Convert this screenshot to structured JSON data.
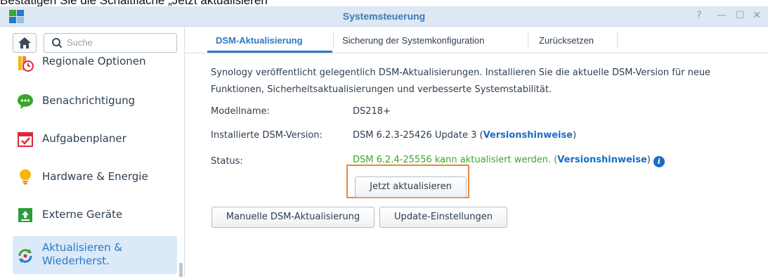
{
  "caption": "Bestätigen Sie die Schaltfläche „Jetzt aktualisieren“",
  "window": {
    "title": "Systemsteuerung",
    "help_glyph": "?",
    "minimize_glyph": "—",
    "maximize_glyph": "☐",
    "close_glyph": "✕"
  },
  "sidebar": {
    "search_placeholder": "Suche",
    "items": [
      {
        "label": "Regionale Optionen",
        "icon": "regional-options-icon",
        "color": "#f08a24"
      },
      {
        "label": "Benachrichtigung",
        "icon": "notification-icon",
        "color": "#3aa62c"
      },
      {
        "label": "Aufgabenplaner",
        "icon": "task-scheduler-icon",
        "color": "#e0283a"
      },
      {
        "label": "Hardware & Energie",
        "icon": "hardware-power-icon",
        "color": "#f5b700"
      },
      {
        "label": "Externe Geräte",
        "icon": "external-devices-icon",
        "color": "#2e9b3a"
      },
      {
        "label_line1": "Aktualisieren &",
        "label_line2": "Wiederherst.",
        "icon": "update-restore-icon",
        "color": "#2c79c7",
        "active": true
      }
    ]
  },
  "tabs": [
    {
      "label": "DSM-Aktualisierung",
      "active": true
    },
    {
      "label": "Sicherung der Systemkonfiguration",
      "active": false
    },
    {
      "label": "Zurücksetzen",
      "active": false
    }
  ],
  "main": {
    "description": "Synology veröffentlicht gelegentlich DSM-Aktualisierungen. Installieren Sie die aktuelle DSM-Version für neue Funktionen, Sicherheitsaktualisierungen und verbesserte Systemstabilität.",
    "model_label": "Modellname:",
    "model_value": "DS218+",
    "installed_label": "Installierte DSM-Version:",
    "installed_value": "DSM 6.2.3-25426 Update 3 (",
    "installed_link": "Versionshinweise",
    "installed_close": ")",
    "status_label": "Status:",
    "status_value": "DSM 6.2.4-25556 kann aktualisiert werden. (",
    "status_link": "Versionshinweise",
    "status_close": ")",
    "update_now_button": "Jetzt aktualisieren",
    "manual_update_button": "Manuelle DSM-Aktualisierung",
    "update_settings_button": "Update-Einstellungen"
  },
  "colors": {
    "accent": "#2c79c7",
    "status_green": "#3aa62c",
    "highlight": "#e8893a"
  }
}
